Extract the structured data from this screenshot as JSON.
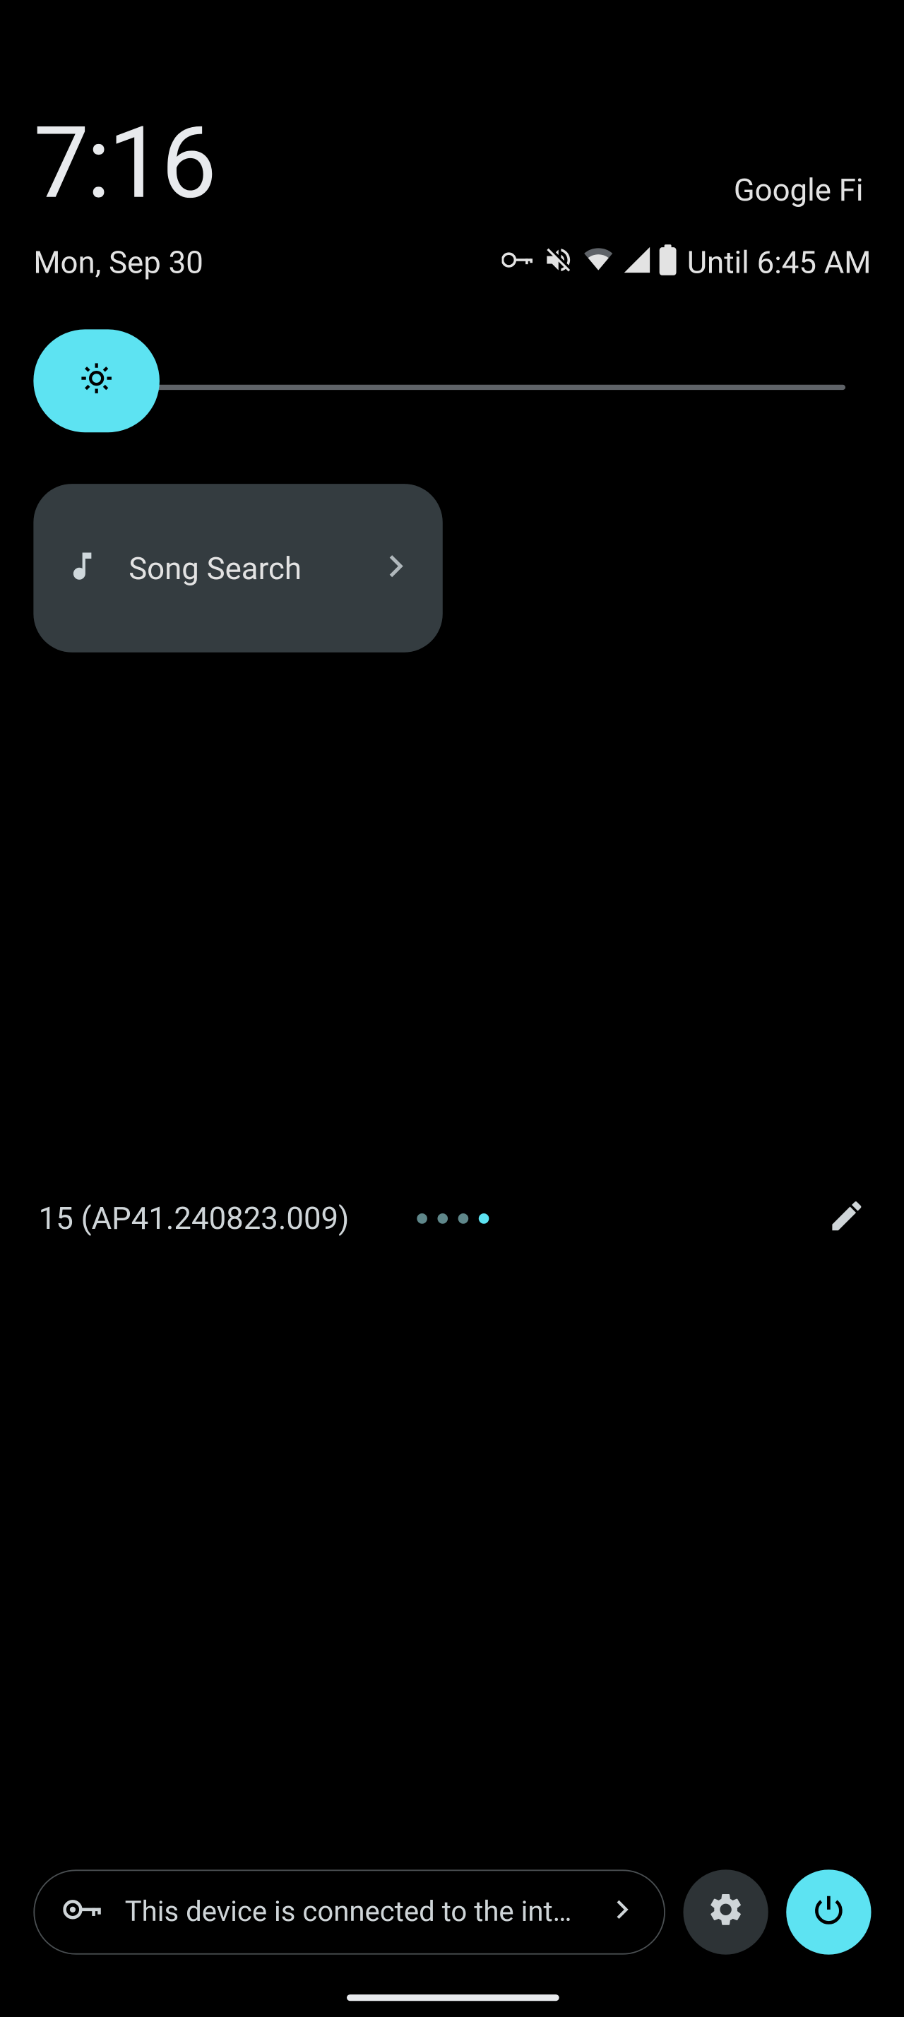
{
  "status": {
    "clock": "7:16",
    "carrier": "Google Fi",
    "date": "Mon, Sep 30",
    "battery_until": "Until 6:45 AM"
  },
  "brightness": {
    "value_pct": 5
  },
  "tile": {
    "label": "Song Search"
  },
  "build": {
    "text": "15 (AP41.240823.009)",
    "page_count": 4,
    "active_page_index": 3
  },
  "bottom": {
    "vpn_text": "This device is connected to the int…"
  },
  "colors": {
    "accent": "#5de3f2",
    "tile_bg": "#343c40",
    "muted": "#5f6368"
  }
}
